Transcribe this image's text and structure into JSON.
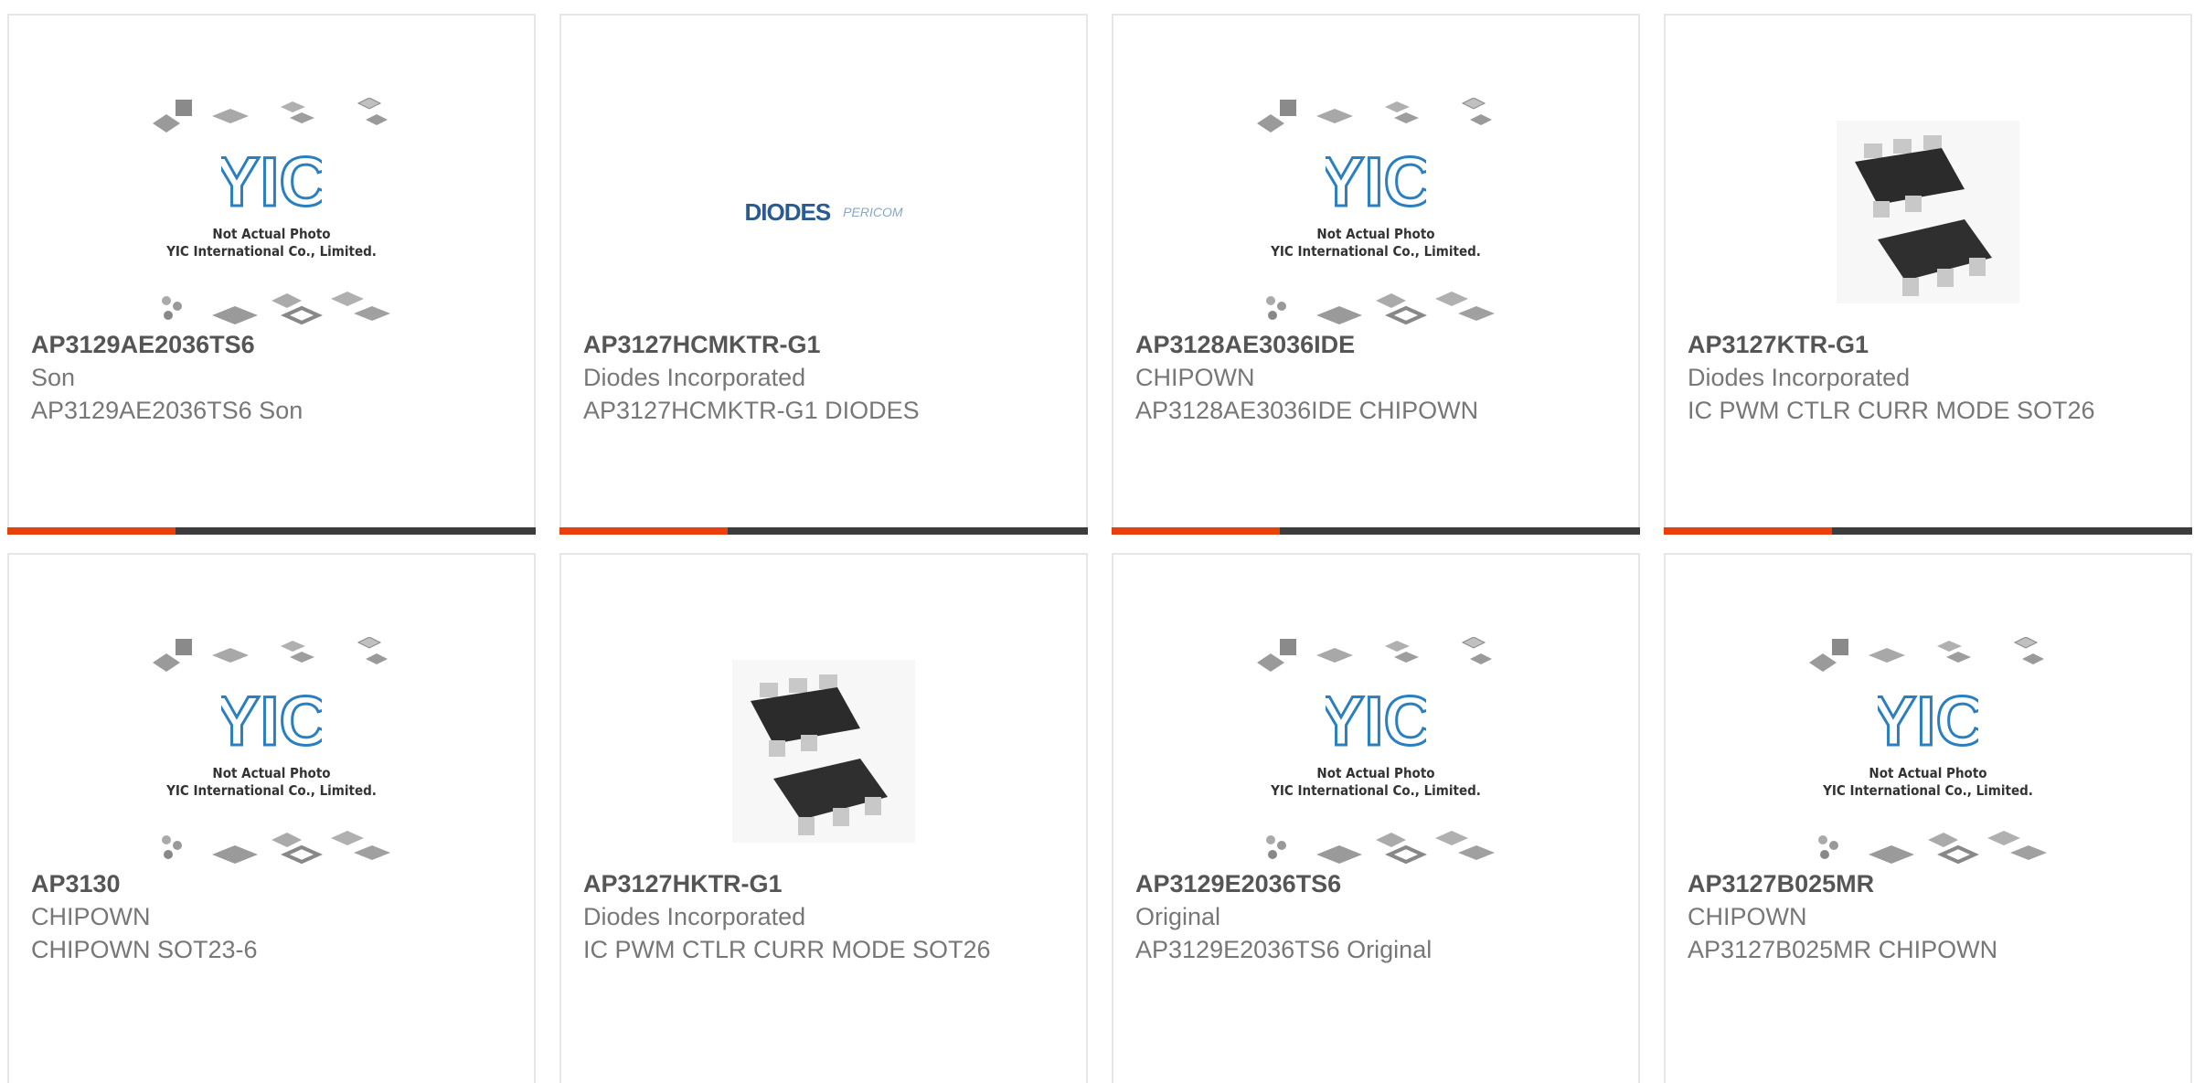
{
  "products": [
    {
      "part_number": "AP3129AE2036TS6",
      "manufacturer": "Son",
      "description": "AP3129AE2036TS6 Son",
      "image": "placeholder"
    },
    {
      "part_number": "AP3127HCMKTR-G1",
      "manufacturer": "Diodes Incorporated",
      "description": "AP3127HCMKTR-G1 DIODES",
      "image": "diodes-logo"
    },
    {
      "part_number": "AP3128AE3036IDE",
      "manufacturer": "CHIPOWN",
      "description": "AP3128AE3036IDE CHIPOWN",
      "image": "placeholder"
    },
    {
      "part_number": "AP3127KTR-G1",
      "manufacturer": "Diodes Incorporated",
      "description": "IC PWM CTLR CURR MODE SOT26",
      "image": "sot26-photo"
    },
    {
      "part_number": "AP3130",
      "manufacturer": "CHIPOWN",
      "description": "CHIPOWN SOT23-6",
      "image": "placeholder"
    },
    {
      "part_number": "AP3127HKTR-G1",
      "manufacturer": "Diodes Incorporated",
      "description": "IC PWM CTLR CURR MODE SOT26",
      "image": "sot26-photo"
    },
    {
      "part_number": "AP3129E2036TS6",
      "manufacturer": "Original",
      "description": "AP3129E2036TS6 Original",
      "image": "placeholder"
    },
    {
      "part_number": "AP3127B025MR",
      "manufacturer": "CHIPOWN",
      "description": "AP3127B025MR CHIPOWN",
      "image": "placeholder"
    }
  ],
  "placeholder": {
    "logo_text": "YIC",
    "caption_line1": "Not Actual Photo",
    "caption_line2": "YIC International Co., Limited."
  },
  "diodes_logo": {
    "brand": "DIODES",
    "sub_brand": "PERICOM"
  },
  "colors": {
    "accent": "#e8400c",
    "bar": "#3c3c3c",
    "yic_blue": "#2a7fc0"
  }
}
